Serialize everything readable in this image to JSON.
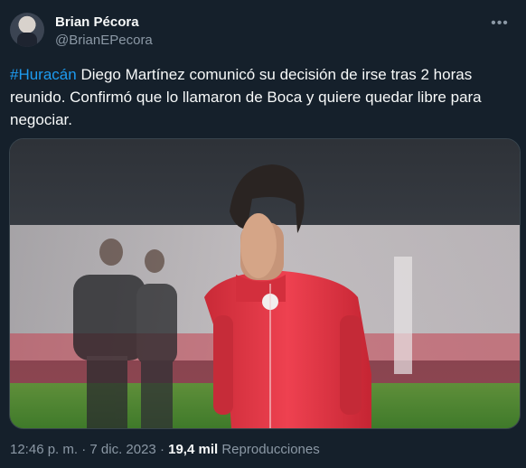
{
  "tweet": {
    "author_name": "Brian Pécora",
    "author_handle": "@BrianEPecora",
    "hashtag": "#Huracán",
    "text": " Diego Martínez comunicó su decisión de irse tras 2 horas reunido. Confirmó que lo llamaron de Boca y quiere quedar libre para negociar.",
    "time": "12:46 p. m.",
    "separator": " · ",
    "date": "7 dic. 2023",
    "views_count": "19,4 mil",
    "views_label": " Reproducciones"
  },
  "icons": {
    "more": "more-dots-icon",
    "avatar": "user-avatar"
  },
  "colors": {
    "background": "#15202b",
    "text": "#f7f9f9",
    "muted": "#8b98a5",
    "link": "#1d9bf0"
  }
}
